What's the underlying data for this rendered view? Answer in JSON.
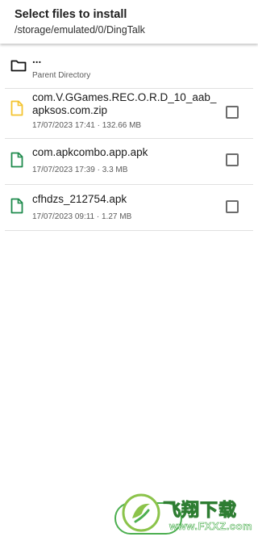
{
  "header": {
    "title": "Select files to install",
    "path": "/storage/emulated/0/DingTalk"
  },
  "parent": {
    "name": "...",
    "label": "Parent Directory",
    "icon": "folder-icon"
  },
  "files": [
    {
      "name": "com.V.GGames.REC.O.R.D_10_aab_apksos.com.zip",
      "meta": "17/07/2023 17:41 · 132.66 MB",
      "icon": "zip-file-icon",
      "icon_color": "#f4c430",
      "checked": false
    },
    {
      "name": "com.apkcombo.app.apk",
      "meta": "17/07/2023 17:39 · 3.3 MB",
      "icon": "apk-file-icon",
      "icon_color": "#1e8a4c",
      "checked": false
    },
    {
      "name": "cfhdzs_212754.apk",
      "meta": "17/07/2023 09:11 · 1.27 MB",
      "icon": "apk-file-icon",
      "icon_color": "#1e8a4c",
      "checked": false
    }
  ],
  "watermark": {
    "cn": "飞翔下载",
    "en": "www.FXXZ.com"
  },
  "colors": {
    "accent": "#4caf50"
  }
}
